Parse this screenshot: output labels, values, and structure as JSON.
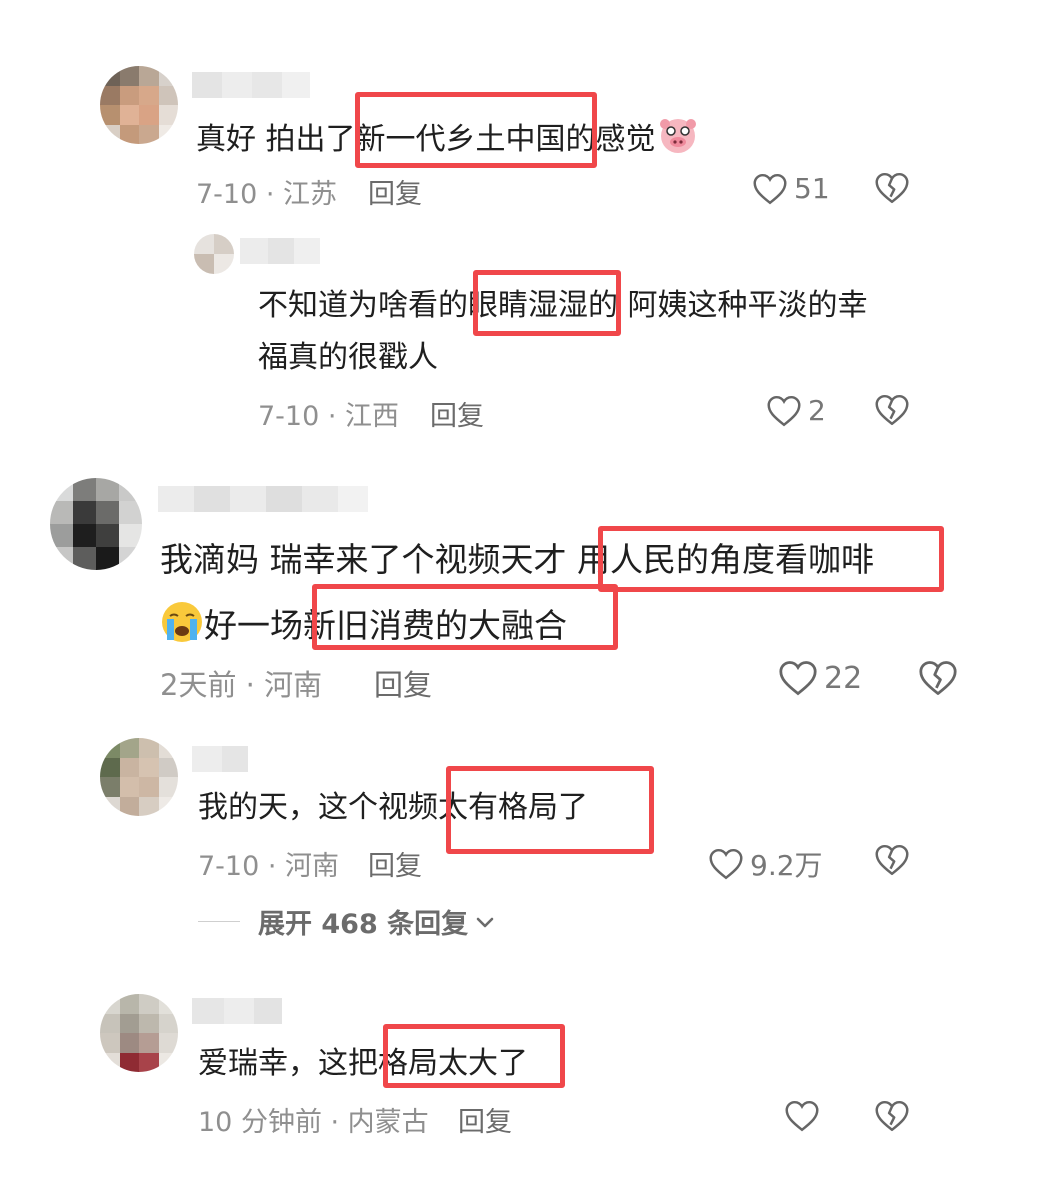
{
  "comments": [
    {
      "text": "真好 拍出了新一代乡土中国的感觉",
      "date_location": "7-10 · 江苏",
      "reply_label": "回复",
      "likes": "51",
      "highlight": "新一代乡土中国",
      "emoji": "pig-face-emoji"
    },
    {
      "line1": "不知道为啥看的眼睛湿湿的 阿姨这种平淡的幸",
      "line2": "福真的很戳人",
      "date_location": "7-10 · 江西",
      "reply_label": "回复",
      "likes": "2",
      "highlight": "眼睛湿湿"
    },
    {
      "line1": "我滴妈 瑞幸来了个视频天才 用人民的角度看咖啡",
      "line2": "好一场新旧消费的大融合",
      "date_location": "2天前 · 河南",
      "reply_label": "回复",
      "likes": "22",
      "highlights": [
        "用人民的角度看咖啡",
        "新旧消费的大融合"
      ],
      "emoji": "crying-face-emoji"
    },
    {
      "text": "我的天，这个视频太有格局了",
      "date_location": "7-10 · 河南",
      "reply_label": "回复",
      "likes": "9.2万",
      "highlight": "太有格局了",
      "expand_label": "展开 468 条回复"
    },
    {
      "text": "爱瑞幸，这把格局太大了",
      "date_location": "10 分钟前 · 内蒙古",
      "reply_label": "回复",
      "likes": "",
      "highlight": "格局太大了"
    }
  ],
  "colors": {
    "highlight_border": "#f0474a",
    "meta_text": "#8f8f8f",
    "body_text": "#1f1f1f"
  },
  "icons": [
    "heart-outline-icon",
    "broken-heart-icon",
    "chevron-down-icon"
  ]
}
